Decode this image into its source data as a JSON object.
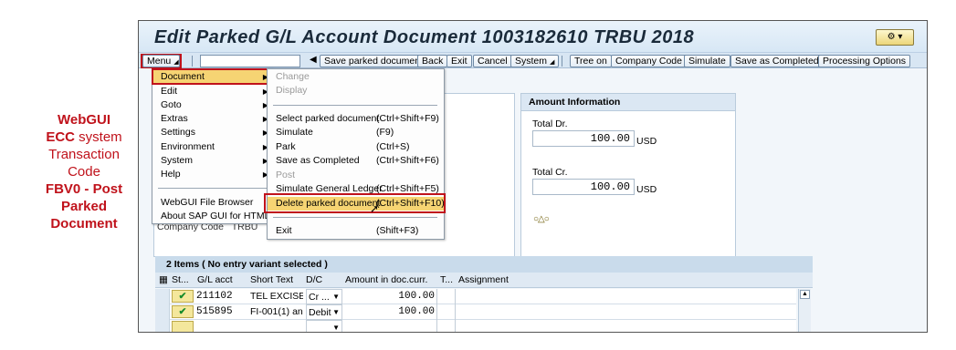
{
  "caption": {
    "line1": "WebGUI",
    "line2a": "ECC",
    "line2b": " system",
    "line3": "Transaction",
    "line4": "Code",
    "line5": "FBV0 - Post",
    "line6": "Parked",
    "line7": "Document"
  },
  "window": {
    "title": "Edit Parked G/L Account Document 1003182610 TRBU 2018",
    "logo_icon": "sap-help-icon"
  },
  "toolbar": {
    "menu_label": "Menu",
    "buttons": [
      "Save parked document",
      "Back",
      "Exit",
      "Cancel",
      "System",
      "Tree on",
      "Company Code",
      "Simulate",
      "Save as Completed",
      "Processing Options"
    ]
  },
  "main_menu": {
    "items": [
      "Document",
      "Edit",
      "Goto",
      "Extras",
      "Settings",
      "Environment",
      "System",
      "Help"
    ],
    "extra_items": [
      "WebGUI File Browser",
      "About SAP GUI for HTML"
    ]
  },
  "doc_menu": {
    "items": [
      {
        "label": "Change",
        "shortcut": ""
      },
      {
        "label": "Display",
        "shortcut": ""
      },
      {
        "label": "Select parked document",
        "shortcut": "(Ctrl+Shift+F9)"
      },
      {
        "label": "Simulate",
        "shortcut": "(F9)"
      },
      {
        "label": "Park",
        "shortcut": "(Ctrl+S)"
      },
      {
        "label": "Save as Completed",
        "shortcut": "(Ctrl+Shift+F6)"
      },
      {
        "label": "Post",
        "shortcut": ""
      },
      {
        "label": "Simulate General Ledger",
        "shortcut": "(Ctrl+Shift+F5)"
      },
      {
        "label": "Delete parked document",
        "shortcut": "(Ctrl+Shift+F10)"
      },
      {
        "label": "Exit",
        "shortcut": "(Shift+F3)"
      }
    ]
  },
  "amount_info": {
    "heading": "Amount Information",
    "total_dr_label": "Total Dr.",
    "total_dr_value": "100.00",
    "total_dr_currency": "USD",
    "total_cr_label": "Total Cr.",
    "total_cr_value": "100.00",
    "total_cr_currency": "USD",
    "lights": "○△○"
  },
  "hidden_fields": {
    "company_code_label": "Company Code",
    "company_code_value": "TRBU"
  },
  "items": {
    "heading": "2 Items ( No entry variant selected )",
    "columns": [
      "St...",
      "G/L acct",
      "Short Text",
      "D/C",
      "Amount in doc.curr.",
      "T...",
      "Assignment"
    ],
    "rows": [
      {
        "status": "✔",
        "gl": "211102",
        "text": "TEL EXCISE T",
        "dc": "Cr ...",
        "amount": "100.00"
      },
      {
        "status": "✔",
        "gl": "515895",
        "text": "FI-001(1) and",
        "dc": "Debit",
        "amount": "100.00"
      },
      {
        "status": "",
        "gl": "",
        "text": "",
        "dc": "",
        "amount": ""
      }
    ]
  }
}
